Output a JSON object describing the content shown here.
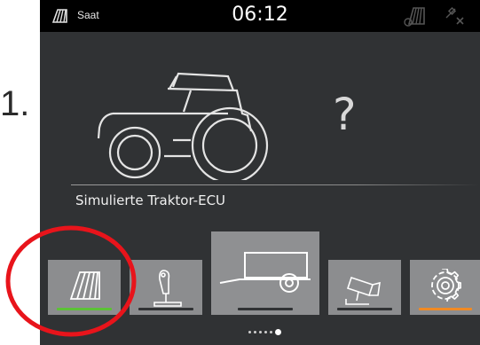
{
  "annotation": {
    "step_number": "1."
  },
  "status_bar": {
    "mode_label": "Saat",
    "time": "06:12",
    "left_icon": "field-work-icon",
    "right_icons": [
      "field-work-disabled-icon",
      "gps-disabled-icon"
    ]
  },
  "main": {
    "device_icon": "tractor-icon",
    "unknown_symbol": "?",
    "device_name": "Simulierte Traktor-ECU"
  },
  "tiles": [
    {
      "icon": "field-work-icon",
      "indicator_color": "#5cc236"
    },
    {
      "icon": "joystick-icon",
      "indicator_color": "#303234"
    },
    {
      "icon": "trailer-icon",
      "indicator_color": "#303234",
      "selected": true
    },
    {
      "icon": "camera-icon",
      "indicator_color": "#303234"
    },
    {
      "icon": "gear-icon",
      "indicator_color": "#f08a24"
    }
  ],
  "pagination": {
    "total": 6,
    "current": 6
  },
  "colors": {
    "screen_bg": "#303234",
    "status_bg": "#000000",
    "tile_bg": "#8c8d8f",
    "highlight": "#e8141b"
  }
}
